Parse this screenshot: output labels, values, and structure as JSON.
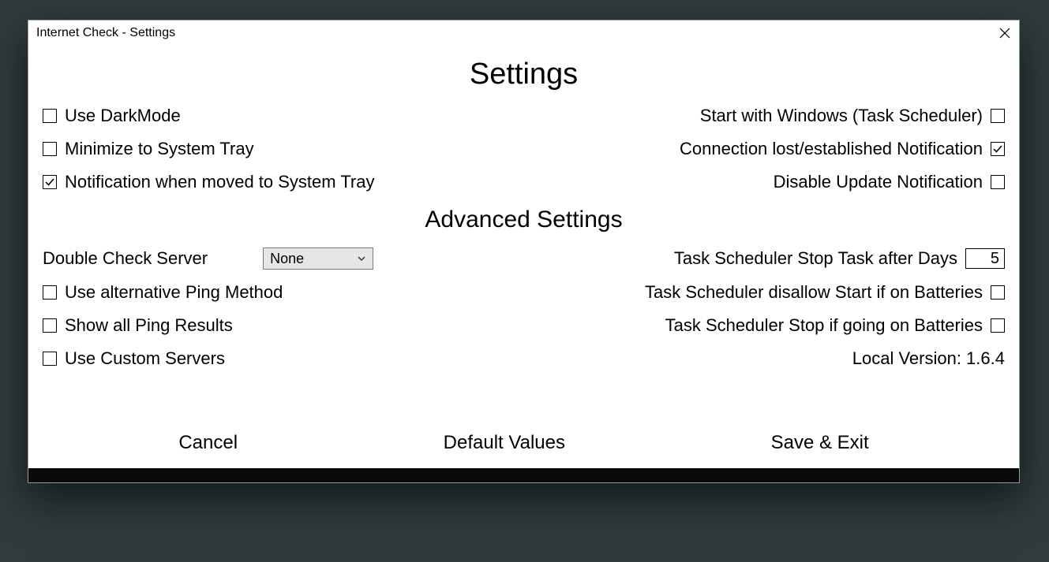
{
  "window": {
    "title": "Internet Check - Settings"
  },
  "headings": {
    "main": "Settings",
    "advanced": "Advanced Settings"
  },
  "general": {
    "left": [
      {
        "label": "Use DarkMode",
        "checked": false
      },
      {
        "label": "Minimize to System Tray",
        "checked": false
      },
      {
        "label": "Notification when moved to System Tray",
        "checked": true
      }
    ],
    "right": [
      {
        "label": "Start with Windows (Task Scheduler)",
        "checked": false
      },
      {
        "label": "Connection lost/established Notification",
        "checked": true
      },
      {
        "label": "Disable Update Notification",
        "checked": false
      }
    ]
  },
  "advanced": {
    "double_check_label": "Double Check Server",
    "double_check_value": "None",
    "stop_days_label": "Task Scheduler Stop Task after Days",
    "stop_days_value": "5",
    "left_checks": [
      {
        "label": "Use alternative Ping Method",
        "checked": false
      },
      {
        "label": "Show all Ping Results",
        "checked": false
      },
      {
        "label": "Use Custom Servers",
        "checked": false
      }
    ],
    "right_checks": [
      {
        "label": "Task Scheduler disallow Start if on Batteries",
        "checked": false
      },
      {
        "label": "Task Scheduler Stop if going on Batteries",
        "checked": false
      }
    ],
    "local_version": "Local Version: 1.6.4"
  },
  "buttons": {
    "cancel": "Cancel",
    "defaults": "Default Values",
    "save": "Save & Exit"
  }
}
